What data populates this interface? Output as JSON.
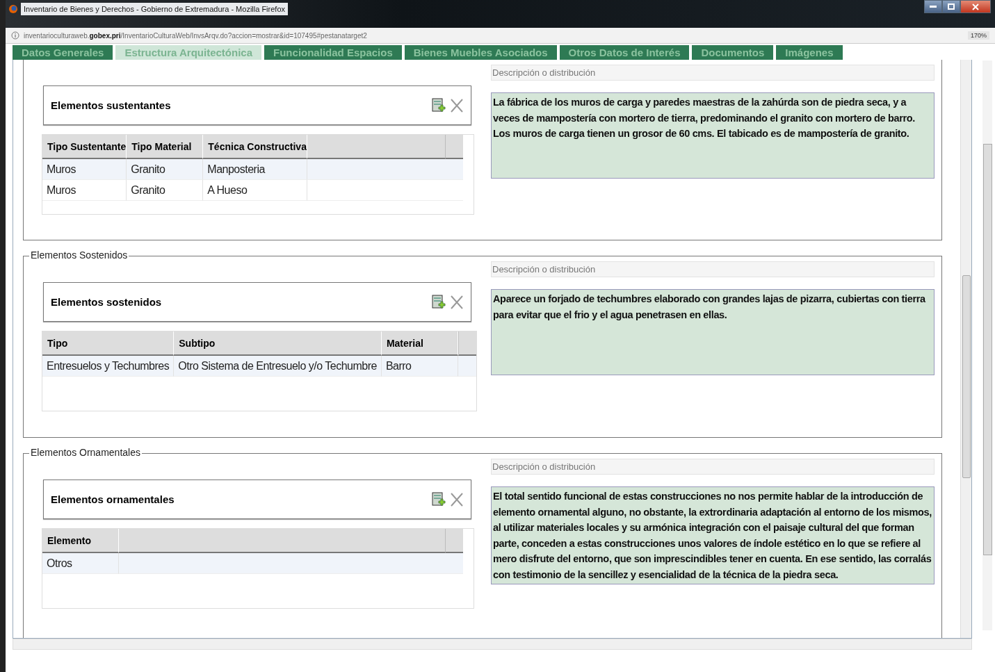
{
  "window": {
    "title": "Inventario de Bienes y Derechos - Gobierno de Extremadura - Mozilla Firefox"
  },
  "address_bar": {
    "url_start": "inventarioculturaweb.",
    "url_domain": "gobex.pri",
    "url_rest": "/InventarioCulturaWeb/InvsArqv.do?accion=mostrar&id=107495#pestanatarget2",
    "zoom": "170%"
  },
  "tabs": [
    {
      "label": "Datos Generales",
      "selected": false
    },
    {
      "label": "Estructura Arquitectónica",
      "selected": true
    },
    {
      "label": "Funcionalidad Espacios",
      "selected": false
    },
    {
      "label": "Bienes Muebles Asociados",
      "selected": false
    },
    {
      "label": "Otros Datos de Interés",
      "selected": false
    },
    {
      "label": "Documentos",
      "selected": false
    },
    {
      "label": "Imágenes",
      "selected": false
    }
  ],
  "sections": [
    {
      "panel_title": "Elementos sustentantes",
      "columns": [
        "Tipo Sustentante",
        "Tipo Material",
        "Técnica Constructiva"
      ],
      "rows": [
        [
          "Muros",
          "Granito",
          "Manposteria"
        ],
        [
          "Muros",
          "Granito",
          "A Hueso"
        ]
      ],
      "description": {
        "placeholder": "Descripción o distribución",
        "value": "La fábrica de los muros de carga y paredes maestras de la zahúrda son de piedra seca, y a veces de mampostería con mortero de tierra, predominando el granito con mortero de barro. Los muros de carga tienen un grosor de 60 cms. El tabicado es de mampostería de granito."
      }
    },
    {
      "legend": "Elementos Sostenidos",
      "panel_title": "Elementos sostenidos",
      "columns": [
        "Tipo",
        "Subtipo",
        "Material"
      ],
      "rows": [
        [
          "Entresuelos y Techumbres",
          "Otro Sistema de Entresuelo y/o Techumbre",
          "Barro"
        ]
      ],
      "description": {
        "placeholder": "Descripción o distribución",
        "value": "Aparece un forjado de techumbres elaborado con grandes lajas de pizarra, cubiertas con tierra para evitar que el frio y el agua penetrasen en ellas."
      }
    },
    {
      "legend": "Elementos Ornamentales",
      "panel_title": "Elementos ornamentales",
      "columns": [
        "Elemento"
      ],
      "rows": [
        [
          "Otros"
        ]
      ],
      "description": {
        "placeholder": "Descripción o distribución",
        "value": "El total sentido funcional de estas construcciones no nos permite hablar de la introducción de elemento ornamental alguno, no obstante, la extrordinaria adaptación al entorno de los mismos, al utilizar materiales locales y su armónica integración con el paisaje cultural del que forman parte, conceden a estas construcciones unos valores de índole estético en lo que se refiere al mero disfrute del entorno, que son imprescindibles tener en cuenta. En ese sentido, las corralás con testimonio de la sencillez y esencialidad de la técnica de la piedra seca."
      }
    }
  ]
}
